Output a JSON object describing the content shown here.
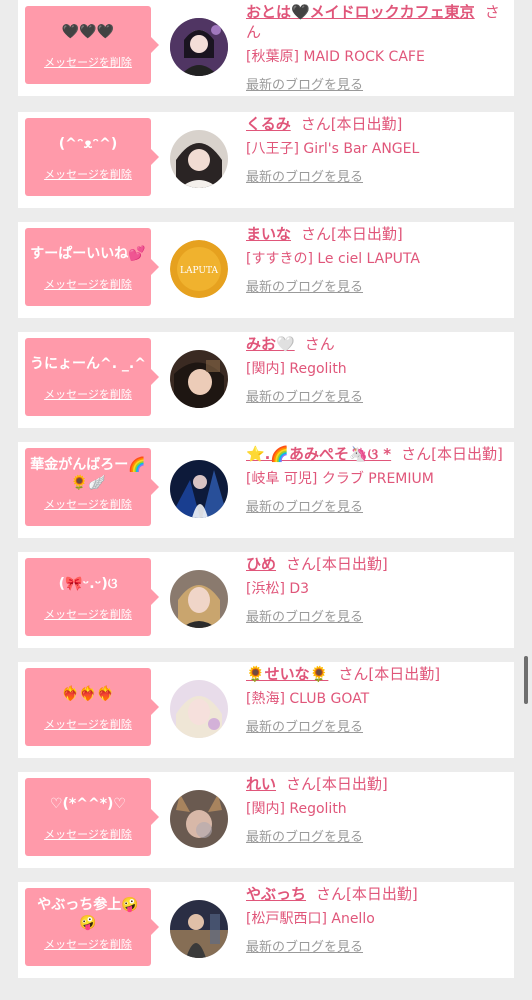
{
  "accent_color": "#ff9aaa",
  "name_color": "#e0567a",
  "link_color": "#9a9a9a",
  "delete_label": "メッセージを削除",
  "blog_label": "最新のブログを見る",
  "cards": [
    {
      "message": "🖤🖤🖤",
      "name": "おとは🖤メイドロックカフェ東京",
      "suffix": "さん",
      "shop": "[秋葉原] MAID ROCK CAFE"
    },
    {
      "message": "(^ᵔᴥᵔ^)",
      "name": "くるみ",
      "suffix": "さん[本日出勤]",
      "shop": "[八王子] Girl's Bar ANGEL"
    },
    {
      "message": "すーぱーいいね💕",
      "name": "まいな",
      "suffix": "さん[本日出勤]",
      "shop": "[すすきの] Le ciel LAPUTA"
    },
    {
      "message": "うにょーん^. _.^",
      "name": "みお🤍",
      "suffix": "さん",
      "shop": "[関内] Regolith"
    },
    {
      "message": "華金がんばろー🌈🌻🪽",
      "name": "⭐️.🌈あみぺそ🦄ଓ *",
      "suffix": "さん[本日出勤]",
      "shop": "[岐阜 可児] クラブ PREMIUM"
    },
    {
      "message": "(🎀ᵕ.ᵕ)ଓ",
      "name": "ひめ",
      "suffix": "さん[本日出勤]",
      "shop": "[浜松] D3"
    },
    {
      "message": "❤️‍🔥❤️‍🔥❤️‍🔥",
      "name": "🌻せいな🌻",
      "suffix": "さん[本日出勤]",
      "shop": "[熱海] CLUB GOAT"
    },
    {
      "message": "♡(*^^*)♡",
      "name": "れい",
      "suffix": "さん[本日出勤]",
      "shop": "[関内] Regolith"
    },
    {
      "message": "やぶっち参上🤪🤪",
      "name": "やぶっち",
      "suffix": "さん[本日出勤]",
      "shop": "[松戸駅西口] Anello"
    }
  ]
}
